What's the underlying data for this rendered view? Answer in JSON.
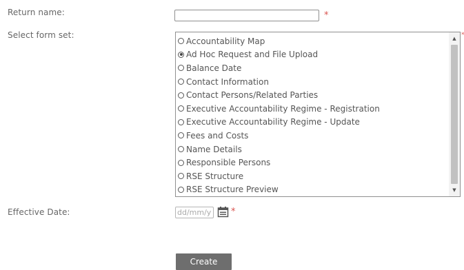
{
  "form": {
    "return_name_label": "Return name:",
    "return_name_value": "",
    "select_form_set_label": "Select form set:",
    "effective_date_label": "Effective Date:",
    "effective_date_placeholder": "dd/mm/yyyy",
    "required_marker": "*",
    "create_button": "Create"
  },
  "form_set_options": [
    {
      "label": "Accountability Map",
      "selected": false
    },
    {
      "label": "Ad Hoc Request and File Upload",
      "selected": true
    },
    {
      "label": "Balance Date",
      "selected": false
    },
    {
      "label": "Contact Information",
      "selected": false
    },
    {
      "label": "Contact Persons/Related Parties",
      "selected": false
    },
    {
      "label": "Executive Accountability Regime - Registration",
      "selected": false
    },
    {
      "label": "Executive Accountability Regime - Update",
      "selected": false
    },
    {
      "label": "Fees and Costs",
      "selected": false
    },
    {
      "label": "Name Details",
      "selected": false
    },
    {
      "label": "Responsible Persons",
      "selected": false
    },
    {
      "label": "RSE Structure",
      "selected": false
    },
    {
      "label": "RSE Structure Preview",
      "selected": false
    }
  ],
  "icons": {
    "calendar": "calendar-icon",
    "scroll_up": "scroll-up-arrow-icon",
    "scroll_down": "scroll-down-arrow-icon"
  },
  "colors": {
    "required": "#d9534f",
    "button_bg": "#6e6e6e",
    "label_text": "#666666"
  }
}
